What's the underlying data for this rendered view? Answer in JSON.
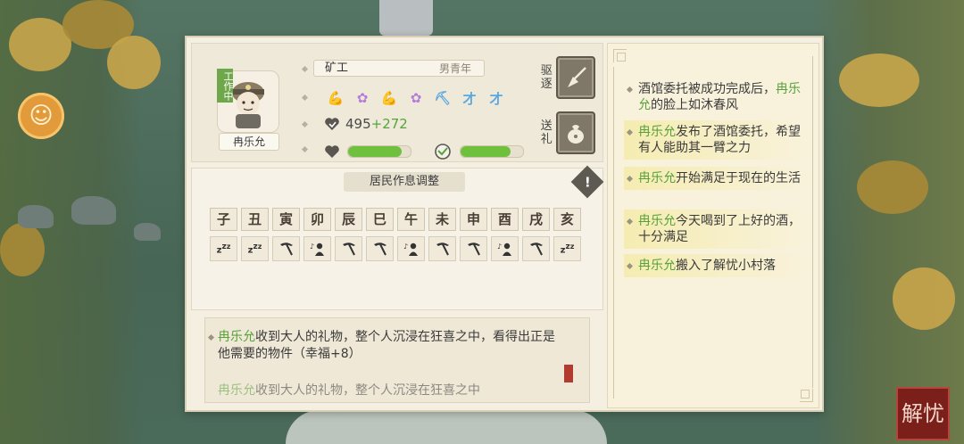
{
  "character": {
    "name": "冉乐允",
    "status_tag": "工作中",
    "job": "矿工",
    "demographic": "男青年",
    "wealth_base": "495",
    "wealth_bonus": "+272",
    "health_level": 0.85,
    "happiness_level": 0.8,
    "traits": [
      {
        "icon": "muscle-arm-icon",
        "color": "#5fb0e6",
        "glyph": "💪"
      },
      {
        "icon": "brain-icon",
        "color": "#b57cd8",
        "glyph": "✿"
      },
      {
        "icon": "strong-arm-icon",
        "color": "#4bb84a",
        "glyph": "💪"
      },
      {
        "icon": "brain-icon",
        "color": "#b57cd8",
        "glyph": "✿"
      },
      {
        "icon": "pickaxe-icon",
        "color": "#5aa8e0",
        "glyph": "⛏"
      },
      {
        "icon": "talent-icon",
        "color": "#5aa8e0",
        "glyph": "才"
      },
      {
        "icon": "talent-icon",
        "color": "#5aa8e0",
        "glyph": "才"
      }
    ]
  },
  "actions": {
    "expel_label": "驱逐",
    "gift_label": "送礼"
  },
  "schedule": {
    "title": "居民作息调整",
    "hours": [
      "子",
      "丑",
      "寅",
      "卯",
      "辰",
      "巳",
      "午",
      "未",
      "申",
      "酉",
      "戌",
      "亥"
    ],
    "activities": [
      "sleep",
      "sleep",
      "work",
      "leisure",
      "work",
      "work",
      "leisure",
      "work",
      "work",
      "leisure",
      "work",
      "sleep"
    ]
  },
  "log": [
    {
      "name": "冉乐允",
      "text": "收到大人的礼物，整个人沉浸在狂喜之中，看得出正是他需要的物件（幸福+8）"
    },
    {
      "name": "冉乐允",
      "text": "收到大人的礼物，整个人沉浸在狂喜之中"
    }
  ],
  "events": [
    {
      "pre": "酒馆委托被成功完成后，",
      "name": "冉乐允",
      "post": "的脸上如沐春风",
      "highlight": false
    },
    {
      "pre": "",
      "name": "冉乐允",
      "post": "发布了酒馆委托，希望有人能助其一臂之力",
      "highlight": true
    },
    {
      "pre": "",
      "name": "冉乐允",
      "post": "开始满足于现在的生活",
      "highlight": true
    },
    {
      "pre": "",
      "name": "冉乐允",
      "post": "今天喝到了上好的酒，十分满足",
      "highlight": true
    },
    {
      "pre": "",
      "name": "冉乐允",
      "post": "搬入了解忧小村落",
      "highlight": true
    }
  ],
  "corner_seal": "解忧"
}
